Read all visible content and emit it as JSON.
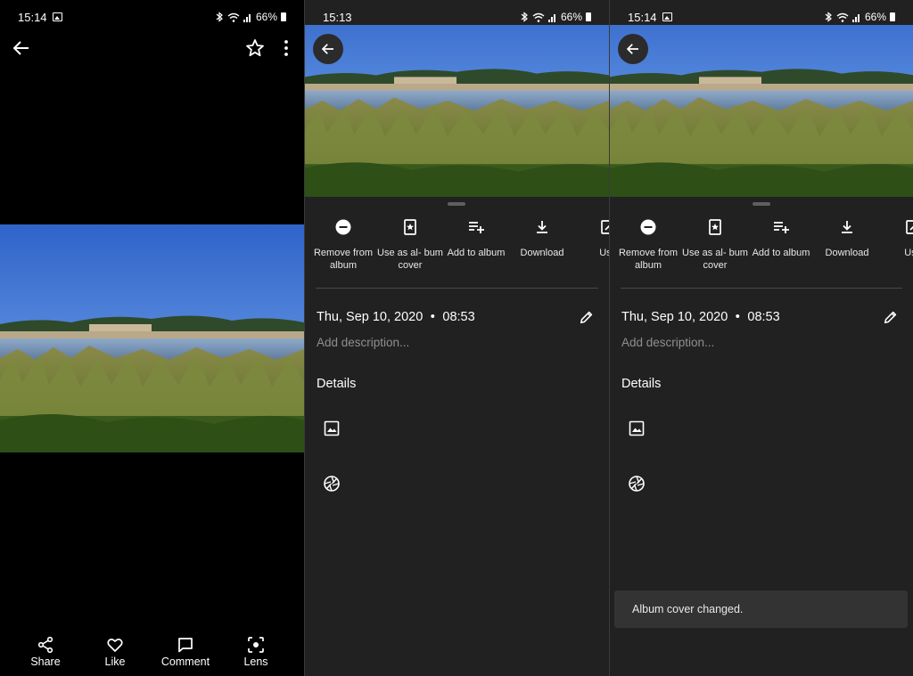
{
  "panel1": {
    "status": {
      "time": "15:14",
      "battery": "66%"
    },
    "bottom_bar": [
      {
        "label": "Share",
        "icon": "share-icon"
      },
      {
        "label": "Like",
        "icon": "heart-icon"
      },
      {
        "label": "Comment",
        "icon": "comment-icon"
      },
      {
        "label": "Lens",
        "icon": "lens-icon"
      }
    ]
  },
  "panel2": {
    "status": {
      "time": "15:13",
      "battery": "66%"
    },
    "actions": [
      {
        "label": "Remove from album",
        "icon": "remove-circle-icon"
      },
      {
        "label": "Use as al- bum cover",
        "icon": "album-cover-icon"
      },
      {
        "label": "Add to album",
        "icon": "playlist-add-icon"
      },
      {
        "label": "Download",
        "icon": "download-icon"
      },
      {
        "label": "Use",
        "icon": "use-as-icon"
      }
    ],
    "date": "Thu, Sep 10, 2020",
    "time": "08:53",
    "description_placeholder": "Add description...",
    "details_heading": "Details"
  },
  "panel3": {
    "status": {
      "time": "15:14",
      "battery": "66%"
    },
    "actions": [
      {
        "label": "Remove from album",
        "icon": "remove-circle-icon"
      },
      {
        "label": "Use as al- bum cover",
        "icon": "album-cover-icon"
      },
      {
        "label": "Add to album",
        "icon": "playlist-add-icon"
      },
      {
        "label": "Download",
        "icon": "download-icon"
      },
      {
        "label": "Use",
        "icon": "use-as-icon"
      }
    ],
    "date": "Thu, Sep 10, 2020",
    "time": "08:53",
    "description_placeholder": "Add description...",
    "details_heading": "Details",
    "snackbar": "Album cover changed."
  },
  "colors": {
    "sheet_bg": "#212121",
    "snackbar_bg": "#333333",
    "placeholder": "#8f8f8f"
  }
}
